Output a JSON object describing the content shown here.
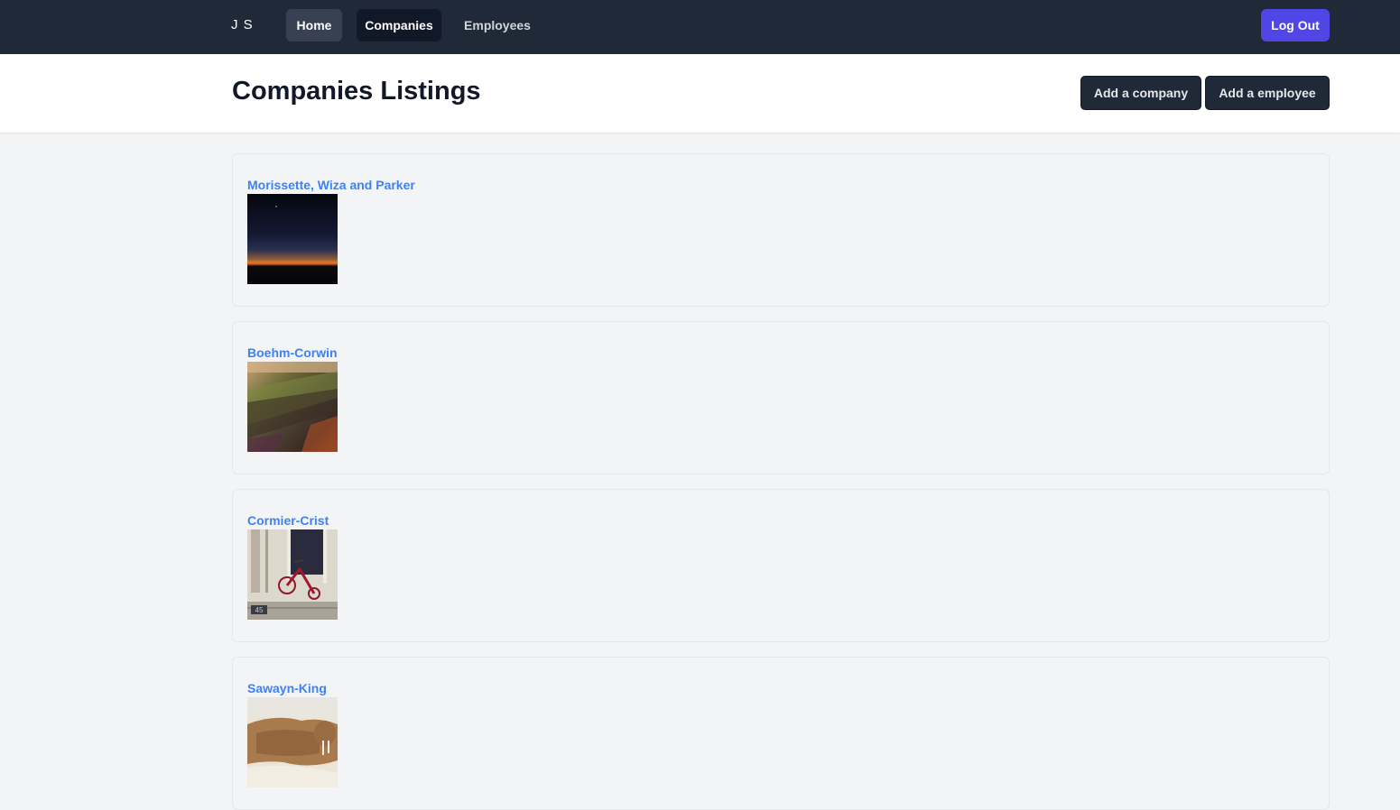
{
  "nav": {
    "brand": "J S",
    "links": [
      {
        "label": "Home"
      },
      {
        "label": "Companies"
      },
      {
        "label": "Employees"
      }
    ],
    "logout_label": "Log Out"
  },
  "header": {
    "title": "Companies Listings",
    "add_company_label": "Add a company",
    "add_employee_label": "Add a employee"
  },
  "companies": [
    {
      "name": "Morissette, Wiza and Parker",
      "logo": "night-horizon-image"
    },
    {
      "name": "Boehm-Corwin",
      "logo": "mossy-log-image"
    },
    {
      "name": "Cormier-Crist",
      "logo": "red-tricycle-image",
      "logo_text": "45"
    },
    {
      "name": "Sawayn-King",
      "logo": "walrus-beach-image"
    }
  ],
  "colors": {
    "nav_bg": "#1f2937",
    "accent": "#4f46e5",
    "link": "#3b82f6",
    "page_bg": "#f3f4f6"
  }
}
